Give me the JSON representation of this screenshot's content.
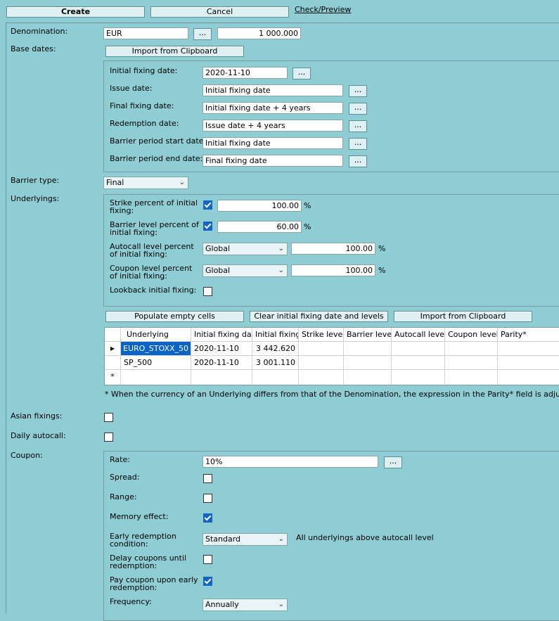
{
  "toolbar": {
    "create": "Create",
    "cancel": "Cancel",
    "check": "Check/Preview"
  },
  "denomination": {
    "label": "Denomination:",
    "currency": "EUR",
    "amount": "1 000.000",
    "browse": "..."
  },
  "base_dates": {
    "label": "Base dates:",
    "import": "Import from Clipboard",
    "rows": [
      {
        "label": "Initial fixing date:",
        "value": "2020-11-10"
      },
      {
        "label": "Issue date:",
        "value": "Initial fixing date"
      },
      {
        "label": "Final fixing date:",
        "value": "Initial fixing date + 4 years"
      },
      {
        "label": "Redemption date:",
        "value": "Issue date + 4 years"
      },
      {
        "label": "Barrier period start date:",
        "value": "Initial fixing date"
      },
      {
        "label": "Barrier period end date:",
        "value": "Final fixing date"
      }
    ]
  },
  "barrier_type": {
    "label": "Barrier type:",
    "value": "Final"
  },
  "underlyings": {
    "label": "Underlyings:",
    "strike": {
      "label": "Strike percent of initial fixing:",
      "checked": true,
      "value": "100.00",
      "unit": "%"
    },
    "barrier": {
      "label": "Barrier level percent of initial fixing:",
      "checked": true,
      "value": "60.00",
      "unit": "%"
    },
    "autocall": {
      "label": "Autocall level percent of initial fixing:",
      "mode": "Global",
      "value": "100.00",
      "unit": "%"
    },
    "coupon": {
      "label": "Coupon level percent of initial fixing:",
      "mode": "Global",
      "value": "100.00",
      "unit": "%"
    },
    "lookback": {
      "label": "Lookback initial fixing:",
      "checked": false
    },
    "buttons": {
      "populate": "Populate empty cells",
      "clear": "Clear initial fixing date and levels",
      "import": "Import from Clipboard"
    },
    "columns": [
      "Underlying",
      "Initial fixing date",
      "Initial fixing",
      "Strike level",
      "Barrier level",
      "Autocall level",
      "Coupon level",
      "Parity*"
    ],
    "rows": [
      [
        "EURO_STOXX_50",
        "2020-11-10",
        "3 442.620",
        "",
        "",
        "",
        "",
        ""
      ],
      [
        "SP_500",
        "2020-11-10",
        "3 001.110",
        "",
        "",
        "",
        "",
        ""
      ]
    ],
    "row_markers": [
      "▶",
      "",
      "*"
    ],
    "footnote": "* When the currency of an Underlying differs from that of the Denomination, the expression in the Parity* field is adjusted by the rele"
  },
  "asian_fixings": {
    "label": "Asian fixings:",
    "checked": false
  },
  "daily_autocall": {
    "label": "Daily autocall:",
    "checked": false
  },
  "coupon": {
    "label": "Coupon:",
    "rate": {
      "label": "Rate:",
      "value": "10%"
    },
    "spread": {
      "label": "Spread:",
      "checked": false
    },
    "range": {
      "label": "Range:",
      "checked": false
    },
    "memory": {
      "label": "Memory effect:",
      "checked": true
    },
    "early_redemption": {
      "label": "Early redemption condition:",
      "value": "Standard",
      "note": "All underlyings above autocall level"
    },
    "delay": {
      "label": "Delay coupons until redemption:",
      "checked": false
    },
    "pay": {
      "label": "Pay coupon upon early redemption:",
      "checked": true
    },
    "frequency": {
      "label": "Frequency:",
      "value": "Annually"
    }
  },
  "colors": {
    "background": "#8ecdd3",
    "accent": "#1565c0",
    "selected_cell": "#0a64c8"
  }
}
